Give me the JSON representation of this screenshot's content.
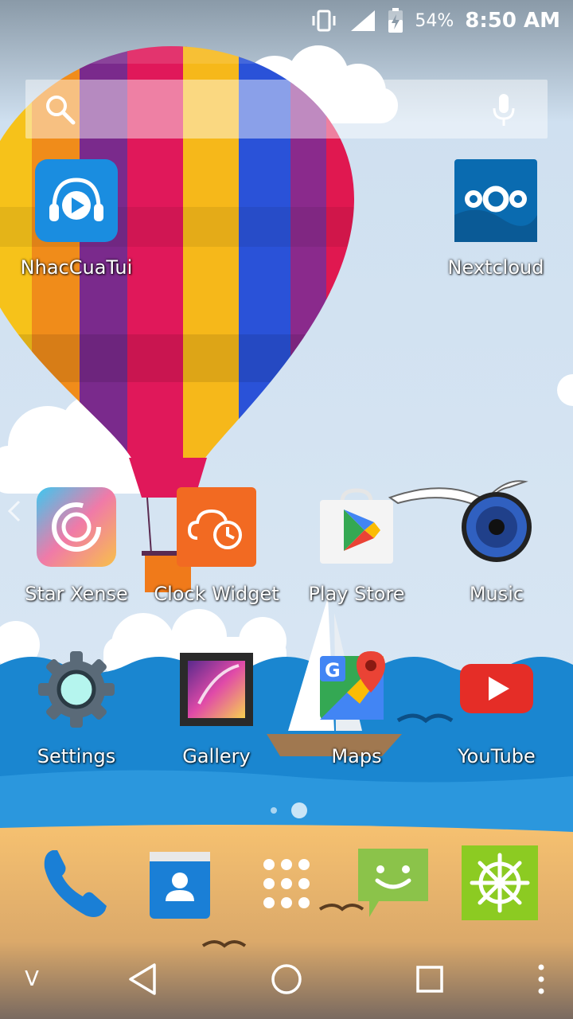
{
  "status": {
    "battery_pct": "54%",
    "time": "8:50 AM"
  },
  "search": {
    "search_icon": "search-icon",
    "mic_icon": "mic-icon"
  },
  "apps": {
    "nhaccuatui": {
      "label": "NhacCuaTui",
      "icon": "nhaccuatui-icon"
    },
    "nextcloud": {
      "label": "Nextcloud",
      "icon": "nextcloud-icon"
    },
    "star_xense": {
      "label": "Star Xense",
      "icon": "star-xense-icon"
    },
    "clock_widget": {
      "label": "Clock Widget",
      "icon": "clock-widget-icon"
    },
    "play_store": {
      "label": "Play Store",
      "icon": "play-store-icon"
    },
    "music": {
      "label": "Music",
      "icon": "music-icon"
    },
    "settings": {
      "label": "Settings",
      "icon": "settings-icon"
    },
    "gallery": {
      "label": "Gallery",
      "icon": "gallery-icon"
    },
    "maps": {
      "label": "Maps",
      "icon": "maps-icon"
    },
    "youtube": {
      "label": "YouTube",
      "icon": "youtube-icon"
    }
  },
  "dock": [
    "phone-icon",
    "contacts-icon",
    "app-drawer-icon",
    "messaging-icon",
    "dharma-wheel-icon"
  ],
  "page_indicator": {
    "pages": 2,
    "current": 2
  },
  "navbar": {
    "collapse_label": "V"
  }
}
